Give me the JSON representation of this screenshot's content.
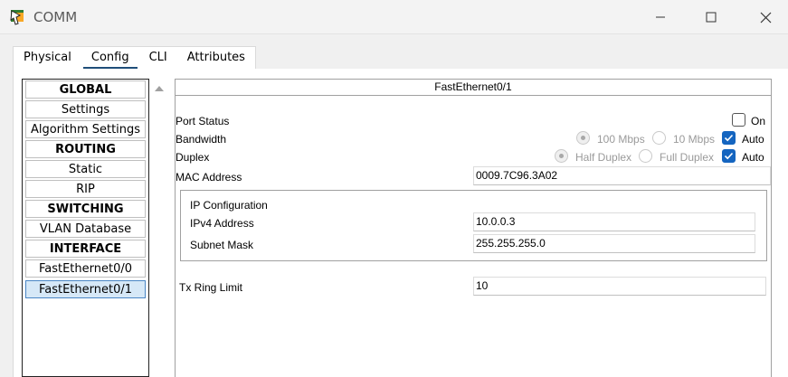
{
  "window": {
    "title": "COMM",
    "minimize_icon": "minimize-icon",
    "maximize_icon": "maximize-icon",
    "close_icon": "close-icon"
  },
  "tabs": [
    {
      "label": "Physical",
      "active": false
    },
    {
      "label": "Config",
      "active": true
    },
    {
      "label": "CLI",
      "active": false
    },
    {
      "label": "Attributes",
      "active": false
    }
  ],
  "nav": {
    "items": [
      {
        "label": "GLOBAL",
        "type": "header"
      },
      {
        "label": "Settings",
        "type": "item"
      },
      {
        "label": "Algorithm Settings",
        "type": "item"
      },
      {
        "label": "ROUTING",
        "type": "header"
      },
      {
        "label": "Static",
        "type": "item"
      },
      {
        "label": "RIP",
        "type": "item"
      },
      {
        "label": "SWITCHING",
        "type": "header"
      },
      {
        "label": "VLAN Database",
        "type": "item"
      },
      {
        "label": "INTERFACE",
        "type": "header"
      },
      {
        "label": "FastEthernet0/0",
        "type": "item"
      },
      {
        "label": "FastEthernet0/1",
        "type": "item",
        "selected": true
      }
    ]
  },
  "panel": {
    "title": "FastEthernet0/1",
    "port_status": {
      "label": "Port Status",
      "on_label": "On",
      "on": false
    },
    "bandwidth": {
      "label": "Bandwidth",
      "options": [
        "100 Mbps",
        "10 Mbps"
      ],
      "selected": "100 Mbps",
      "auto_label": "Auto",
      "auto": true
    },
    "duplex": {
      "label": "Duplex",
      "options": [
        "Half Duplex",
        "Full Duplex"
      ],
      "selected": "Half Duplex",
      "auto_label": "Auto",
      "auto": true
    },
    "mac_address": {
      "label": "MAC Address",
      "value": "0009.7C96.3A02"
    },
    "ip_config": {
      "title": "IP Configuration",
      "ipv4": {
        "label": "IPv4 Address",
        "value": "10.0.0.3"
      },
      "subnet": {
        "label": "Subnet Mask",
        "value": "255.255.255.0"
      }
    },
    "tx_ring_limit": {
      "label": "Tx Ring Limit",
      "value": "10"
    }
  },
  "colors": {
    "accent": "#1565c0",
    "tab_underline": "#1f4e79",
    "selected_item_bg": "#d6e8f7"
  }
}
